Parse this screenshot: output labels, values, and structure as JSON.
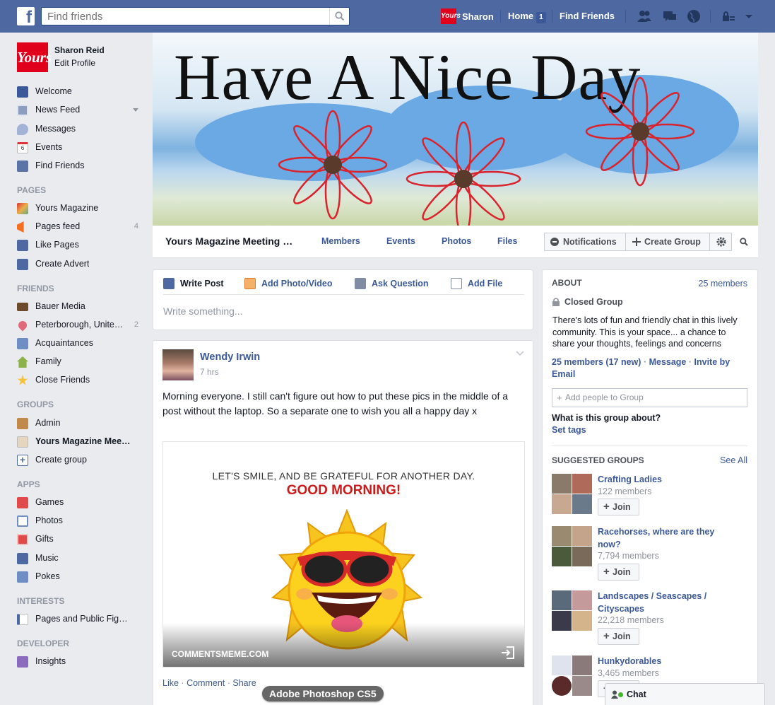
{
  "topbar": {
    "logo": "f",
    "search_placeholder": "Find friends",
    "user_name": "Sharon",
    "user_logo_text": "Yours",
    "home_label": "Home",
    "home_count": "1",
    "find_friends_label": "Find Friends"
  },
  "profile": {
    "logo_text": "Yours",
    "name": "Sharon Reid",
    "edit": "Edit Profile"
  },
  "leftnav": {
    "main": [
      {
        "label": "Welcome",
        "icon": "fb-icon"
      },
      {
        "label": "News Feed",
        "icon": "news-feed-icon"
      },
      {
        "label": "Messages",
        "icon": "messages-icon"
      },
      {
        "label": "Events",
        "icon": "calendar-icon"
      },
      {
        "label": "Find Friends",
        "icon": "friends-icon"
      }
    ],
    "pages_head": "PAGES",
    "pages": [
      {
        "label": "Yours Magazine",
        "count": ""
      },
      {
        "label": "Pages feed",
        "count": "4"
      },
      {
        "label": "Like Pages",
        "count": ""
      },
      {
        "label": "Create Advert",
        "count": ""
      }
    ],
    "friends_head": "FRIENDS",
    "friends": [
      {
        "label": "Bauer Media",
        "count": ""
      },
      {
        "label": "Peterborough, Unite…",
        "count": "2"
      },
      {
        "label": "Acquaintances",
        "count": ""
      },
      {
        "label": "Family",
        "count": ""
      },
      {
        "label": "Close Friends",
        "count": ""
      }
    ],
    "groups_head": "GROUPS",
    "groups": [
      {
        "label": "Admin"
      },
      {
        "label": "Yours Magazine Mee…"
      },
      {
        "label": "Create group"
      }
    ],
    "apps_head": "APPS",
    "apps": [
      {
        "label": "Games"
      },
      {
        "label": "Photos"
      },
      {
        "label": "Gifts"
      },
      {
        "label": "Music"
      },
      {
        "label": "Pokes"
      }
    ],
    "interests_head": "INTERESTS",
    "interests": [
      {
        "label": "Pages and Public Fig…"
      }
    ],
    "developer_head": "DEVELOPER",
    "developer": [
      {
        "label": "Insights"
      }
    ]
  },
  "cover": {
    "title": "Have A Nice Day"
  },
  "group_bar": {
    "name": "Yours Magazine Meeting …",
    "tabs": [
      "Members",
      "Events",
      "Photos",
      "Files"
    ],
    "notifications": "Notifications",
    "create_group": "Create Group"
  },
  "composer": {
    "tabs": [
      "Write Post",
      "Add Photo/Video",
      "Ask Question",
      "Add File"
    ],
    "placeholder": "Write something..."
  },
  "post": {
    "author": "Wendy Irwin",
    "time": "7 hrs",
    "body": "Morning everyone. I still can't figure out how to put these pics in the middle of a post without the laptop. So a separate one to wish you all a happy day x",
    "image_line1": "LET'S SMILE, AND BE GRATEFUL FOR ANOTHER DAY.",
    "image_line2": "GOOD MORNING!",
    "image_credit": "COMMENTSMEME.COM",
    "like": "Like",
    "comment": "Comment",
    "share": "Share"
  },
  "tooltip": "Adobe Photoshop CS5",
  "about": {
    "heading": "ABOUT",
    "members_link": "25 members",
    "privacy": "Closed Group",
    "description": "There's lots of fun and friendly chat in this lively community. This is your space... a chance to share your thoughts, feelings and concerns",
    "members_stat": "25 members (17 new)",
    "message": "Message",
    "invite": "Invite by Email",
    "add_people_placeholder": "Add people to Group",
    "question": "What is this group about?",
    "set_tags": "Set tags"
  },
  "suggested": {
    "heading": "SUGGESTED GROUPS",
    "see_all": "See All",
    "join_label": "Join",
    "groups": [
      {
        "name": "Crafting Ladies",
        "members": "122 members"
      },
      {
        "name": "Racehorses, where are they now?",
        "members": "7,794 members"
      },
      {
        "name": "Landscapes / Seascapes / Cityscapes",
        "members": "22,218 members"
      },
      {
        "name": "Hunkydorables",
        "members": "3,465 members"
      }
    ]
  },
  "chat": {
    "label": "Chat"
  },
  "colors": {
    "topbar": "#4e69a2",
    "link": "#3b5998",
    "brand_red": "#e0001b"
  }
}
